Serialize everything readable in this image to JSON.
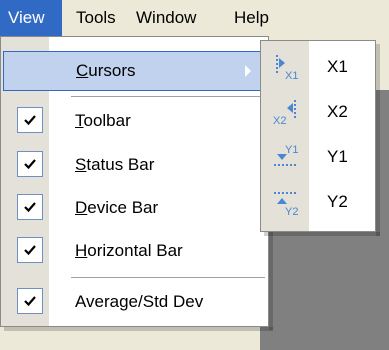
{
  "menubar": {
    "items": [
      {
        "label": "View",
        "active": true
      },
      {
        "label": "Tools",
        "active": false
      },
      {
        "label": "Window",
        "active": false
      },
      {
        "label": "Help",
        "active": false
      }
    ]
  },
  "view_menu": {
    "items": [
      {
        "label": "Cursors",
        "mnemonic": "C",
        "rest": "ursors",
        "checked": false,
        "submenu": true,
        "highlighted": true
      },
      {
        "label": "Toolbar",
        "mnemonic": "T",
        "rest": "oolbar",
        "checked": true
      },
      {
        "label": "Status Bar",
        "mnemonic": "S",
        "rest": "tatus Bar",
        "checked": true
      },
      {
        "label": "Device Bar",
        "mnemonic": "D",
        "rest": "evice Bar",
        "checked": true
      },
      {
        "label": "Horizontal Bar",
        "mnemonic": "H",
        "rest": "orizontal Bar",
        "checked": true
      },
      {
        "label": "Average/Std Dev",
        "mnemonic": "",
        "rest": "Average/Std Dev",
        "checked": true
      }
    ]
  },
  "cursors_submenu": {
    "items": [
      {
        "label": "X1",
        "icon": "cursor-x1-icon"
      },
      {
        "label": "X2",
        "icon": "cursor-x2-icon"
      },
      {
        "label": "Y1",
        "icon": "cursor-y1-icon"
      },
      {
        "label": "Y2",
        "icon": "cursor-y2-icon"
      }
    ]
  },
  "colors": {
    "highlight_bg": "#316ac5",
    "hover_bg": "#c1d2ee",
    "icon_blue": "#4a86d4",
    "menubar_bg": "#ece9d8"
  }
}
